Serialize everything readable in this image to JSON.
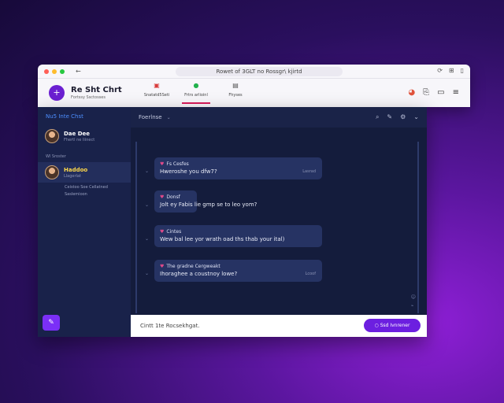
{
  "browser": {
    "url": "Rowet of 3GLT no Rossgr\\ kjirtd",
    "back_icon": "arrow-left-icon"
  },
  "appbar": {
    "title": "Re Sht Chrt",
    "subtitle": "Fortssy Ssctosses",
    "tabs": [
      {
        "label": "Snatatd5Seti",
        "icon": "calendar-icon"
      },
      {
        "label": "Frtrs arlioinl",
        "icon": "chat-bubble-icon"
      },
      {
        "label": "Fhyses",
        "icon": "document-icon"
      }
    ]
  },
  "sidebar": {
    "header": "Nu5 Inte Chst",
    "contacts": [
      {
        "name": "Dae Dee",
        "status": "Fhertl ne Iiinect"
      }
    ],
    "section": "Wl Sroster",
    "selected": {
      "name": "Haddoo",
      "status": "Llagerlat",
      "sub1": "Ceistoo Soe Cellatned",
      "sub2": "Saslemioon"
    },
    "compose_icon": "new-chat-icon"
  },
  "channel": {
    "name": "Foerlnse"
  },
  "messages": [
    {
      "sender": "Fs Cesfes",
      "text": "Hweroshe you dfw7?",
      "time": "Lasrad"
    },
    {
      "sender": "Donsf",
      "text": "Jolt ey Fabis lie gmp se to leo yom?",
      "time": ""
    },
    {
      "sender": "Cintes",
      "text": "Wew bal lee yor wrath oad ths thab your ital)",
      "time": ""
    },
    {
      "sender": "The gradne Cergweakt",
      "text": "Ihoraghee a coustnoy lowe?",
      "time": "Lcoof"
    }
  ],
  "composer": {
    "placeholder": "Cintt 1te Rocsekhgat.",
    "send_label": "Ssd Ivnrener"
  }
}
